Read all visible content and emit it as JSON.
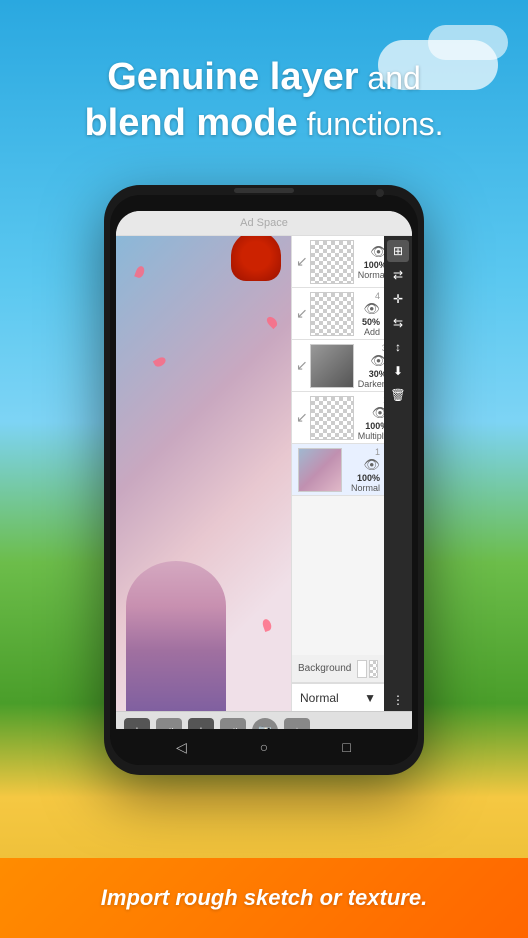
{
  "background": {
    "alt": "Sky and nature background"
  },
  "headline": {
    "line1_bold": "Genuine layer",
    "line1_rest": " and",
    "line2_bold": "blend mode",
    "line2_rest": " functions."
  },
  "ad_bar": {
    "label": "Ad Space"
  },
  "layers": [
    {
      "id": "top",
      "number": "",
      "opacity": "100%",
      "mode": "Normal",
      "thumbnail_type": "empty"
    },
    {
      "id": "4",
      "number": "4",
      "opacity": "50%",
      "mode": "Add",
      "thumbnail_type": "empty"
    },
    {
      "id": "3",
      "number": "3",
      "opacity": "30%",
      "mode": "Darken",
      "thumbnail_type": "dark"
    },
    {
      "id": "2",
      "number": "2",
      "opacity": "100%",
      "mode": "Multiply",
      "thumbnail_type": "empty"
    },
    {
      "id": "1",
      "number": "1",
      "opacity": "100%",
      "mode": "Normal",
      "thumbnail_type": "art"
    }
  ],
  "background_row": {
    "label": "Background"
  },
  "blend_mode_bar": {
    "mode": "Normal"
  },
  "toolbar_icons": [
    "⊞",
    "↕",
    "⤢",
    "⇥",
    "↨",
    "⬇",
    "🗑"
  ],
  "bottom_toolbar": {
    "add_layer": "+",
    "merge": "⇥",
    "add_sub": "+",
    "flatten": "⇥",
    "camera": "📷",
    "import": "↓"
  },
  "phone_nav": {
    "back": "◁",
    "home": "○",
    "recents": "□"
  },
  "orange_banner": {
    "text": "Import rough sketch or texture."
  }
}
